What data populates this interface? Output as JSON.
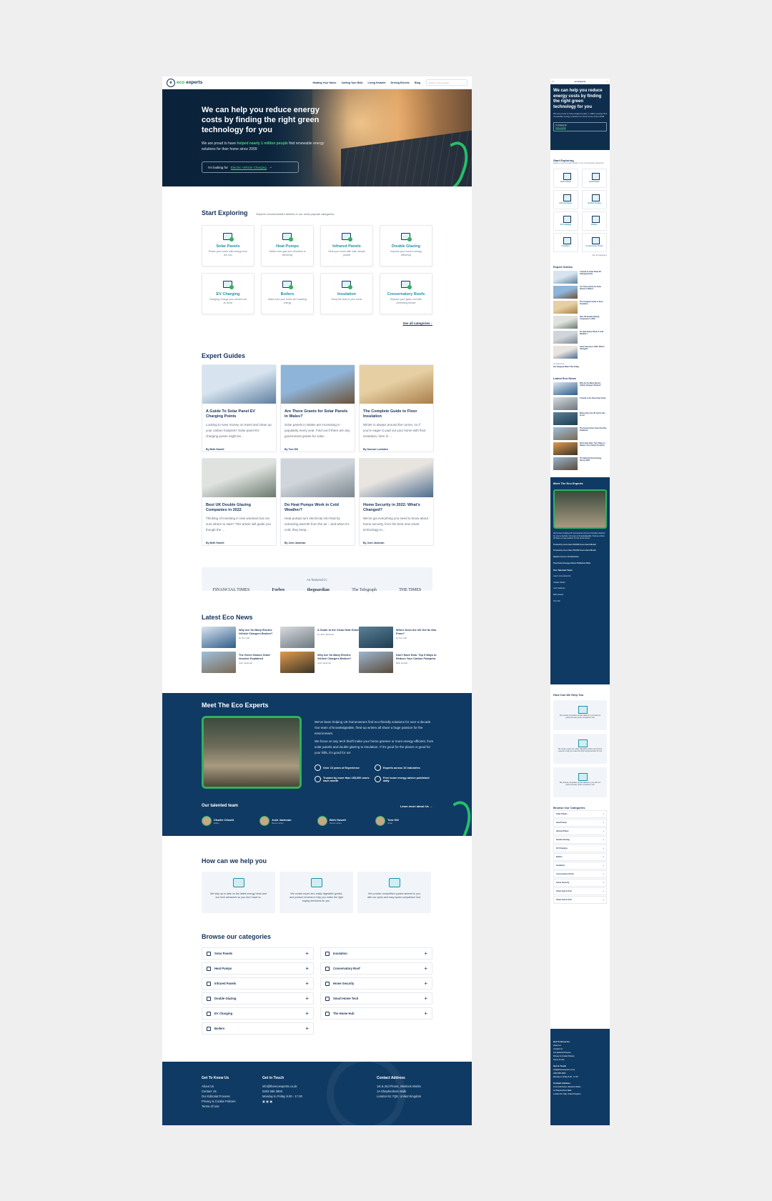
{
  "brand": {
    "logo_eco": "eco",
    "logo_rest": "experts",
    "green": "#2fb15c",
    "navy": "#0f3a63"
  },
  "nav": {
    "items": [
      "Heating Your Home",
      "Cutting Your Bills",
      "Living Smarter",
      "Driving Electric",
      "Blog"
    ],
    "search_placeholder": "Search a new search"
  },
  "hero": {
    "title": "We can help you reduce energy costs by finding the right green technology for you",
    "text_before": "We are proud to have",
    "text_highlight": "helped nearly 1 million people",
    "text_after": "find renewable energy solutions for their home since 2009",
    "looking_label": "I'm looking for",
    "looking_value": "Electric Vehicle Charging"
  },
  "explore": {
    "title": "Start Exploring",
    "subtitle": "Explore recommended articles in our most popular categories",
    "cards": [
      {
        "title": "Solar Panels",
        "desc": "Power your home with energy from the sun"
      },
      {
        "title": "Heat Pumps",
        "desc": "Switch from gas and oil boilers to electricity"
      },
      {
        "title": "Infrared Panels",
        "desc": "Heat your home with safe, simple panels"
      },
      {
        "title": "Double Glazing",
        "desc": "Improve your home's energy efficiency"
      },
      {
        "title": "EV Charging",
        "desc": "Charging Charge your electric car at home"
      },
      {
        "title": "Boilers",
        "desc": "Make sure your boiler isn't wasting energy"
      },
      {
        "title": "Insulation",
        "desc": "Keep the heat in your home"
      },
      {
        "title": "Conservatory Roofs",
        "desc": "Replace your glass roof with something thicker"
      }
    ],
    "see_all": "See all categories"
  },
  "guides": {
    "title": "Expert Guides",
    "cards": [
      {
        "title": "A Guide To Solar Panel EV Charging Points",
        "desc": "Looking to save money on travel and clean up your carbon footprint? Solar panel EV charging points might be...",
        "author": "By Beth Howell",
        "c1": "#d7e4ef",
        "c2": "#5f7fa0"
      },
      {
        "title": "Are There Grants for Solar Panels in Wales?",
        "desc": "Solar panels in Wales are increasing in popularity every year. Find out if there are any government grants for solar...",
        "author": "By Tom Gill",
        "c1": "#8fb4d9",
        "c2": "#6b5238"
      },
      {
        "title": "The Complete Guide to Floor Insulation",
        "desc": "Winter is always around the corner, so if you're eager to pad out your home with floor insulation, here is ...",
        "author": "By Duncan Lombden",
        "c1": "#e6cfa3",
        "c2": "#a97e49"
      },
      {
        "title": "Best UK Double Glazing Companies in 2022",
        "desc": "Thinking of investing in new windows but not sure where to start? This article will guide you though the ...",
        "author": "By Beth Howell",
        "c1": "#dfe2df",
        "c2": "#6b7a6d"
      },
      {
        "title": "Do Heat Pumps Work in Cold Weather?",
        "desc": "Heat pumps turn electricity into heat by extracting warmth from the air – and when it's cold, they keep...",
        "author": "By Josh Jackman",
        "c1": "#cfd5da",
        "c2": "#7c8790"
      },
      {
        "title": "Home Security in 2022: What's Changed?",
        "desc": "We've got everything you need to know about home security, from the best new smart technology to...",
        "author": "By Josh Jackman",
        "c1": "#e8e4df",
        "c2": "#4e6d8f"
      }
    ]
  },
  "press": {
    "label": "As featured in:",
    "logos": [
      "FINANCIAL TIMES",
      "Forbes",
      "theguardian",
      "The Telegraph",
      "THE TIMES"
    ]
  },
  "news": {
    "title": "Latest Eco News",
    "items": [
      {
        "title": "Why Are So Many Electric Vehicle Chargers Broken?",
        "author": "by Tom Gill",
        "c1": "#dbe6f0",
        "c2": "#2f5c8a"
      },
      {
        "title": "A Guide to the Clean Heat Grant",
        "author": "by Josh Jackman",
        "c1": "#d8dcdf",
        "c2": "#6c7780"
      },
      {
        "title": "Where Does the UK Get Its Gas From?",
        "author": "by Tom Gill",
        "c1": "#5c8096",
        "c2": "#1d3d52"
      },
      {
        "title": "The Green Homes Grant Voucher Explained",
        "author": "Josh Jackman",
        "c1": "#9fc0dc",
        "c2": "#7a6a55"
      },
      {
        "title": "Why Are So Many Electric Vehicle Chargers Broken?",
        "author": "Josh Jackman",
        "c1": "#e09a4e",
        "c2": "#3a3426"
      },
      {
        "title": "Don't Have Kids: Top 5 Ways to Reduce Your Carbon Footprint",
        "author": "Beth Howell",
        "c1": "#9cb7d0",
        "c2": "#5a4a3a"
      }
    ]
  },
  "meet": {
    "title": "Meet The Eco Experts",
    "p1": "We've been helping UK homeowners find eco-friendly solutions for over a decade. Our team of knowledgeable, fired-up writers all share a huge passion for the environment.",
    "p2": "We focus on any tech that'll make your home greener or more energy efficient, from solar panels and double glazing to insulation. If it's good for the planet or good for your bills, it's good for us!",
    "features": [
      "Over 13 years of Experience",
      "Experts across 10 industries",
      "Trusted by more than 150,000 users each month",
      "Free home energy advice published daily"
    ],
    "team_label": "Our talented team",
    "learn_more": "Learn more about Us",
    "team": [
      {
        "name": "Charlie Clissitt",
        "role": "Editor"
      },
      {
        "name": "Josh Jackman",
        "role": "Senior writer"
      },
      {
        "name": "Beth Howell",
        "role": "Senior writer"
      },
      {
        "name": "Tom Gill",
        "role": "writer"
      }
    ]
  },
  "help": {
    "title": "How can we help you",
    "cards": [
      "We stay up to date on the latest energy news and eco tech advances so you don't have to.",
      "We create expert-led, easily digestible guides and product reviews to help you make the right buying decisions for you.",
      "We provide competitive quotes tailored to you with our quick and easy quote-comparison tool."
    ]
  },
  "browse": {
    "title": "Browse our categories",
    "left": [
      "Solar Panels",
      "Heat Pumps",
      "Infrared Panels",
      "Double Glazing",
      "EV Charging",
      "Boilers"
    ],
    "right": [
      "Insulation",
      "Conservatory Roof",
      "Home Security",
      "Smart Home Tech",
      "The Home Hub"
    ]
  },
  "footer": {
    "col1_title": "Get To Know Us",
    "col1": [
      "About Us",
      "Contact Us",
      "Our Editorial Process",
      "Privacy & Cookie Policies",
      "Terms of Use"
    ],
    "col2_title": "Get in Touch",
    "col2": [
      "info@theecoexperts.co.uk",
      "0203 595 3800",
      "Monday to Friday 9.00 - 17.00"
    ],
    "col3_title": "Contact Address",
    "col3": [
      "1st & 2nd Floors, Wenlock Works",
      "1A Shepherdess Walk",
      "London N1 7QE, United Kingdom"
    ]
  },
  "mobile": {
    "hero_title": "We can help you reduce energy costs by finding the right green technology for you",
    "hero_text": "We are proud to have helped nearly 1 million people find renewable energy solutions for their home since 2009",
    "looking_label": "I'm looking for",
    "looking_value": "Solar Panels",
    "explore_title": "Start Exploring",
    "explore_sub": "Explore recommended articles in our most popular categories",
    "cats": [
      "Solar Panels",
      "Heat Pumps",
      "Infrared Panels",
      "Double Glazing",
      "EV Charging",
      "Boilers",
      "Insulation",
      "Conservatory Roofs"
    ],
    "see_all": "See all categories",
    "guides_title": "Expert Guides",
    "guides": [
      "A Guide To Solar Panel EV Charging Points",
      "Are There Grants for Solar Panels in Wales?",
      "The Complete Guide to Floor Insulation",
      "Best UK Double Glazing Companies in 2022",
      "Do Heat Pumps Work in Cold Weather?",
      "Home Security in 2022: What's Changed?"
    ],
    "press": "As featured in",
    "press_logos": "bes  theguardian  The Teleg",
    "news_title": "Latest Eco News",
    "news": [
      "Why Are So Many Electric Vehicle Chargers Broken?",
      "A Guide to the Clean Heat Grant",
      "Where Does the UK Get Its Gas From?",
      "The Green Homes Grant Voucher Explained",
      "Don't Have Kids: Top 5 Ways to Reduce Your Carbon Footprint",
      "The National Home Energy Survey 2022"
    ],
    "meet_title": "Meet The Eco Experts",
    "meet_text": "We've been helping UK homeowners find eco-friendly solutions for over a decade. Our team of knowledgeable, fired-up writers all share a huge passion for the environment.",
    "features": [
      "Trusted by more than 150,000 Users Each Month",
      "Trusted by more than 150,000 Users Each Month",
      "Experts Across 10 Industries",
      "Free Home Energy Advice Published Daily"
    ],
    "team_label": "Our Talented Team",
    "learn_more": "Learn more about Us",
    "team": [
      "Charlie Clissitt",
      "Josh Jackman",
      "Beth Howell",
      "Tom Gill"
    ],
    "help_title": "How Can We Help You",
    "help": [
      "We provide competitive quotes tailored to you with our quick and easy quote comparison tool",
      "We create expert-led, easily digestible guides and product reviews to help you make the right buying decision for you",
      "We provide competitive quotes tailored to you with our quick and easy quote comparison tool"
    ],
    "browse_title": "Browse Our Categories",
    "browse": [
      "Solar Panels",
      "Heat Pumps",
      "Infrared Panel",
      "Double Glazing",
      "EV Charging",
      "Boilers",
      "Insulation",
      "Conservatory Roofs",
      "Home Security",
      "Smart Home Tech",
      "Smart Home Tech"
    ],
    "foot1_title": "Get To Know Us",
    "foot1": [
      "About Us",
      "Contact Us",
      "Our Editorial Process",
      "Privacy & Cookie Policies",
      "Terms of Use"
    ],
    "foot2_title": "Get In Touch",
    "foot2": [
      "info@theecoexperts.co.uk",
      "0203 595 3800",
      "Monday to Friday 9.00 - 17.00"
    ],
    "foot3_title": "Contact Address",
    "foot3": [
      "1st & 2nd Floors, Wenlock Works",
      "1A Shepherdess Walk",
      "London N1 7QE, United Kingdom"
    ]
  }
}
